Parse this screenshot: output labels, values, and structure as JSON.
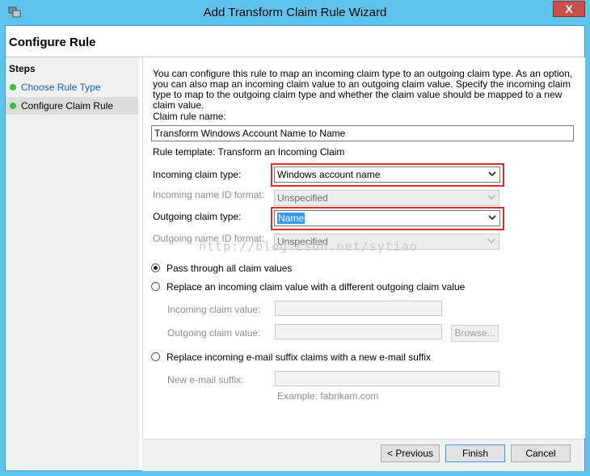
{
  "window": {
    "title": "Add Transform Claim Rule Wizard",
    "close_label": "X"
  },
  "page": {
    "header_title": "Configure Rule"
  },
  "steps": {
    "title": "Steps",
    "items": [
      {
        "label": "Choose Rule Type",
        "state": "link"
      },
      {
        "label": "Configure Claim Rule",
        "state": "current"
      }
    ]
  },
  "form": {
    "description": "You can configure this rule to map an incoming claim type to an outgoing claim type. As an option, you can also map an incoming claim value to an outgoing claim value. Specify the incoming claim type to map to the outgoing claim type and whether the claim value should be mapped to a new claim value.",
    "rule_name_label": "Claim rule name:",
    "rule_name_value": "Transform Windows Account Name to Name",
    "rule_template": "Rule template: Transform an Incoming Claim",
    "incoming_type_label": "Incoming claim type:",
    "incoming_type_value": "Windows account name",
    "incoming_nameid_label": "Incoming name ID format:",
    "incoming_nameid_value": "Unspecified",
    "outgoing_type_label": "Outgoing claim type:",
    "outgoing_type_value": "Name",
    "outgoing_nameid_label": "Outgoing name ID format:",
    "outgoing_nameid_value": "Unspecified",
    "radio_pass": "Pass through all claim values",
    "radio_replace": "Replace an incoming claim value with a different outgoing claim value",
    "incoming_value_label": "Incoming claim value:",
    "outgoing_value_label": "Outgoing claim value:",
    "browse_label": "Browse...",
    "radio_email": "Replace incoming e-mail suffix claims with a new e-mail suffix",
    "new_suffix_label": "New e-mail suffix:",
    "example": "Example: fabrikam.com"
  },
  "watermark": "http://blog.csdn.net/sytiao",
  "buttons": {
    "previous": "< Previous",
    "finish": "Finish",
    "cancel": "Cancel"
  },
  "colors": {
    "titlebar": "#5ec4ee",
    "close": "#c7504c",
    "highlight": "#e02b2b",
    "link": "#1a64b5",
    "step_dot": "#3cbf3c"
  }
}
